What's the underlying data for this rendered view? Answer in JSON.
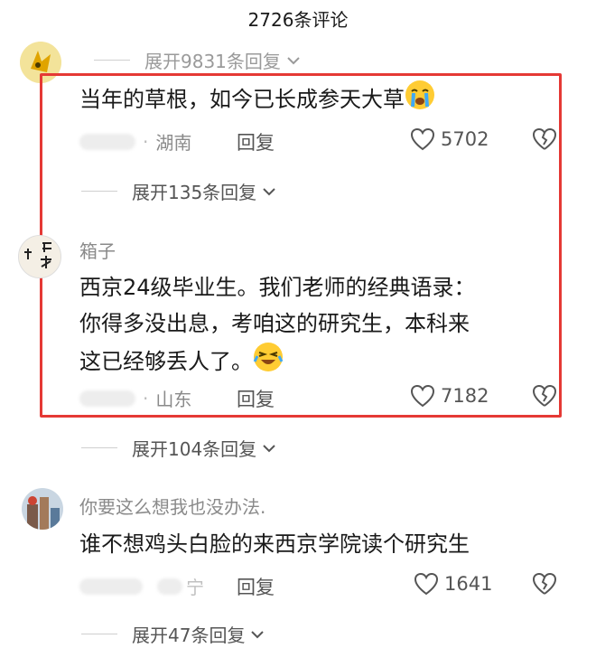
{
  "header": {
    "title": "2726条评论"
  },
  "top_expand": {
    "label": "展开9831条回复"
  },
  "comments": [
    {
      "text": "当年的草根，如今已长成参天大草",
      "location": "湖南",
      "reply_label": "回复",
      "likes": "5702",
      "expand_label": "展开135条回复",
      "emoji": "crying-face-emoji"
    },
    {
      "username": "箱子",
      "lines": [
        "西京24级毕业生。我们老师的经典语录：",
        "你得多没出息，考咱这的研究生，本科来",
        "这已经够丢人了。"
      ],
      "location": "山东",
      "reply_label": "回复",
      "likes": "7182",
      "expand_label": "展开104条回复",
      "emoji": "laughing-crying-emoji",
      "avatar_text": [
        "闻",
        "识"
      ]
    },
    {
      "username": "你要这么想我也没办法.",
      "text": "谁不想鸡头白脸的来西京学院读个研究生",
      "location": "宁",
      "reply_label": "回复",
      "likes": "1641",
      "expand_label": "展开47条回复"
    }
  ],
  "colors": {
    "highlight": "#e53935",
    "text": "#1a1a1a",
    "meta": "#8a8a8a"
  }
}
